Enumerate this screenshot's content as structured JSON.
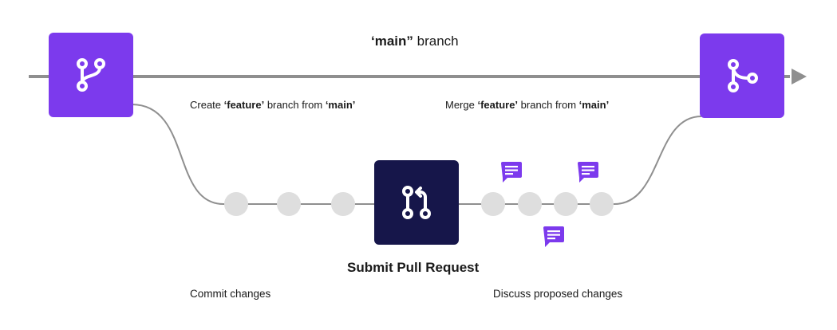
{
  "main_branch": {
    "quote_text": "‘main”",
    "rest_text": " branch"
  },
  "create_label": {
    "prefix": "Create ",
    "feature": "‘feature’",
    "middle": " branch from ",
    "main": "‘main’"
  },
  "merge_label": {
    "prefix": "Merge ",
    "feature": "‘feature’",
    "middle": " branch from ",
    "main": "‘main’"
  },
  "pull_request_title": "Submit Pull Request",
  "commit_label": "Commit changes",
  "discuss_label": "Discuss proposed changes",
  "icons": {
    "branch_box": "git-branch-icon",
    "merge_box": "git-merge-icon",
    "pr_box": "git-pull-request-icon",
    "comment": "comment-icon"
  },
  "colors": {
    "accent": "#7c3aed",
    "pr_box": "#16164a",
    "line": "#8f8f8f",
    "dot": "#dedede",
    "comment": "#7c3aed"
  }
}
